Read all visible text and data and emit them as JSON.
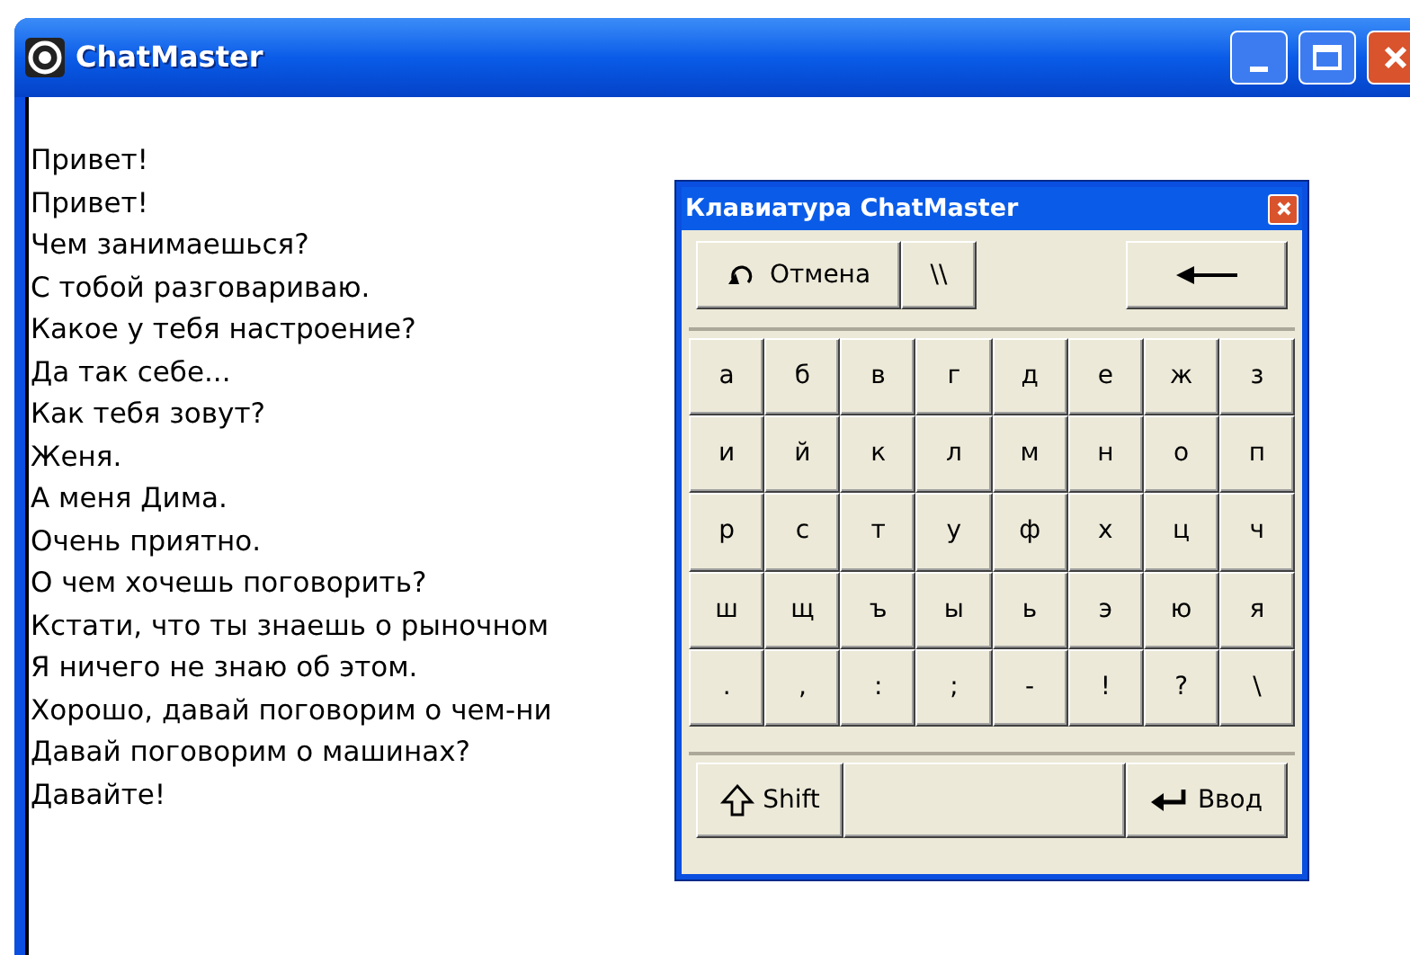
{
  "window": {
    "title": "ChatMaster"
  },
  "chat": {
    "lines": [
      "Привет!",
      "Привет!",
      "Чем занимаешься?",
      "С тобой разговариваю.",
      "Какое у тебя настроение?",
      "Да так себе...",
      "Как тебя зовут?",
      "Женя.",
      "А меня Дима.",
      "Очень приятно.",
      "О чем хочешь поговорить?",
      "Кстати, что ты знаешь о рыночном",
      "Я ничего не знаю об этом.",
      "Хорошо, давай поговорим о чем-ни",
      "Давай поговорим о машинах?",
      "Давайте!"
    ]
  },
  "keyboard": {
    "title": "Клавиатура ChatMaster",
    "undo": "Отмена",
    "slashes": "\\\\",
    "keys": [
      [
        "а",
        "б",
        "в",
        "г",
        "д",
        "е",
        "ж",
        "з"
      ],
      [
        "и",
        "й",
        "к",
        "л",
        "м",
        "н",
        "о",
        "п"
      ],
      [
        "р",
        "с",
        "т",
        "у",
        "ф",
        "х",
        "ц",
        "ч"
      ],
      [
        "ш",
        "щ",
        "ъ",
        "ы",
        "ь",
        "э",
        "ю",
        "я"
      ],
      [
        ".",
        ",",
        ":",
        ";",
        "-",
        "!",
        "?",
        "\\"
      ]
    ],
    "shift": "Shift",
    "enter": "Ввод"
  }
}
